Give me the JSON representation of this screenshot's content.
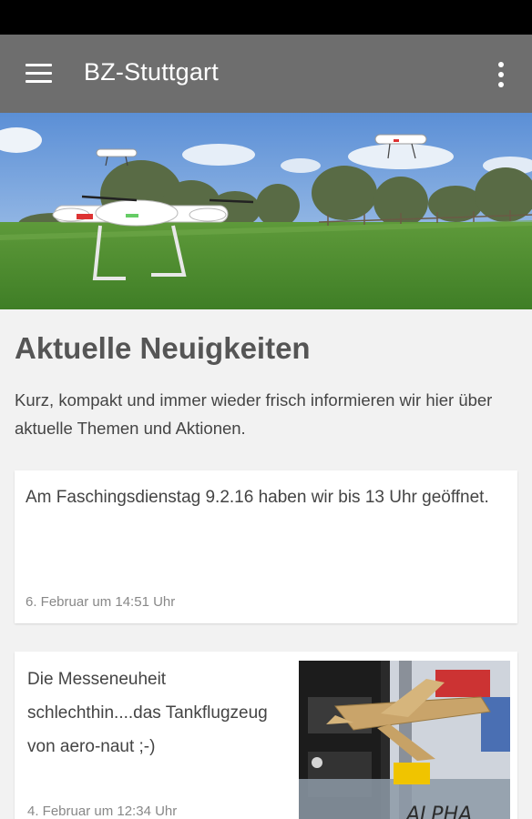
{
  "app": {
    "title": "BZ-Stuttgart"
  },
  "icons": {
    "menu": "hamburger-menu-icon",
    "overflow": "more-vert-icon"
  },
  "colors": {
    "appbar": "#6e6e6e",
    "statusbar": "#000000",
    "background": "#f2f2f2"
  },
  "news": {
    "heading": "Aktuelle Neuigkeiten",
    "intro": "Kurz, kompakt und immer wieder frisch informieren wir hier über aktuelle Themen und Aktionen.",
    "items": [
      {
        "text": "Am Faschingsdienstag 9.2.16 haben wir bis 13 Uhr geöffnet.",
        "date": "6. Februar um 14:51 Uhr"
      },
      {
        "text": "Die Messeneuheit schlechthin....das Tankflugzeug von aero-naut ;-)",
        "date": "4. Februar um 12:34 Uhr",
        "image_brand": "ALPHA"
      }
    ]
  }
}
